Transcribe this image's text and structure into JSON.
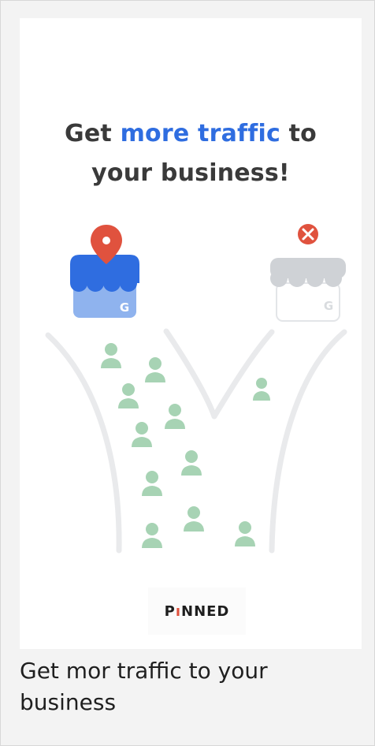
{
  "headline": {
    "part1": "Get ",
    "accent": "more traffic",
    "part2": " to",
    "line2": "your business!"
  },
  "logo": {
    "prefix": "P",
    "pin": "ı",
    "suffix": "NNED"
  },
  "caption": "Get mor traffic to your business",
  "colors": {
    "accent": "#2f6de0",
    "pin_red": "#e0523e",
    "store_awning_blue": "#2f6de0",
    "store_body_blue": "#8fb3ee",
    "store_grey": "#cfd2d6",
    "people_green": "#a7d3b4",
    "road_grey": "#e9eaec"
  },
  "icons": {
    "left_store": "store-with-map-pin-icon",
    "right_store": "store-with-x-mark-icon",
    "people": "person-icon"
  }
}
